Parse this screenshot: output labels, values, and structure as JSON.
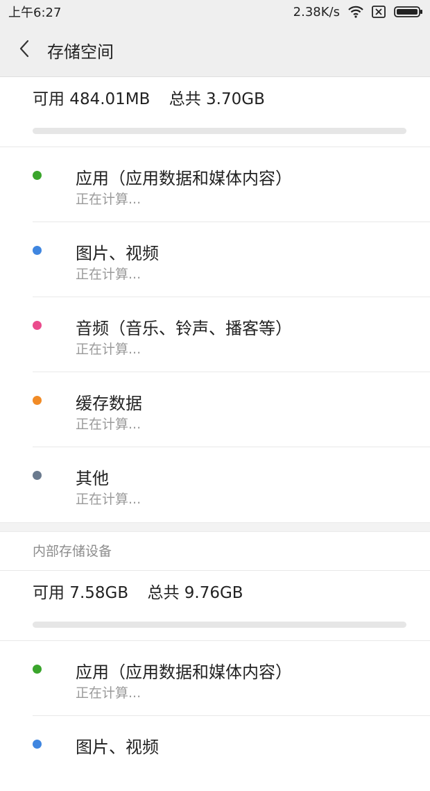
{
  "status_bar": {
    "time": "上午6:27",
    "net_speed": "2.38K/s",
    "icons": [
      "wifi-icon",
      "no-sim-icon",
      "battery-icon"
    ]
  },
  "header": {
    "title": "存储空间",
    "back_icon": "chevron-left-icon"
  },
  "sections": [
    {
      "label": "",
      "available": "可用 484.01MB",
      "total": "总共 3.70GB",
      "usage_fraction": 0.0,
      "categories": [
        {
          "name": "应用（应用数据和媒体内容）",
          "status": "正在计算...",
          "color": "#3aa52c"
        },
        {
          "name": "图片、视频",
          "status": "正在计算...",
          "color": "#3f86e0"
        },
        {
          "name": "音频（音乐、铃声、播客等）",
          "status": "正在计算...",
          "color": "#ea4b8c"
        },
        {
          "name": "缓存数据",
          "status": "正在计算...",
          "color": "#f18b26"
        },
        {
          "name": "其他",
          "status": "正在计算...",
          "color": "#6a7a8e"
        }
      ]
    },
    {
      "label": "内部存储设备",
      "available": "可用 7.58GB",
      "total": "总共 9.76GB",
      "usage_fraction": 0.0,
      "categories": [
        {
          "name": "应用（应用数据和媒体内容）",
          "status": "正在计算...",
          "color": "#3aa52c"
        },
        {
          "name": "图片、视频",
          "status": "",
          "color": "#3f86e0"
        }
      ]
    }
  ]
}
